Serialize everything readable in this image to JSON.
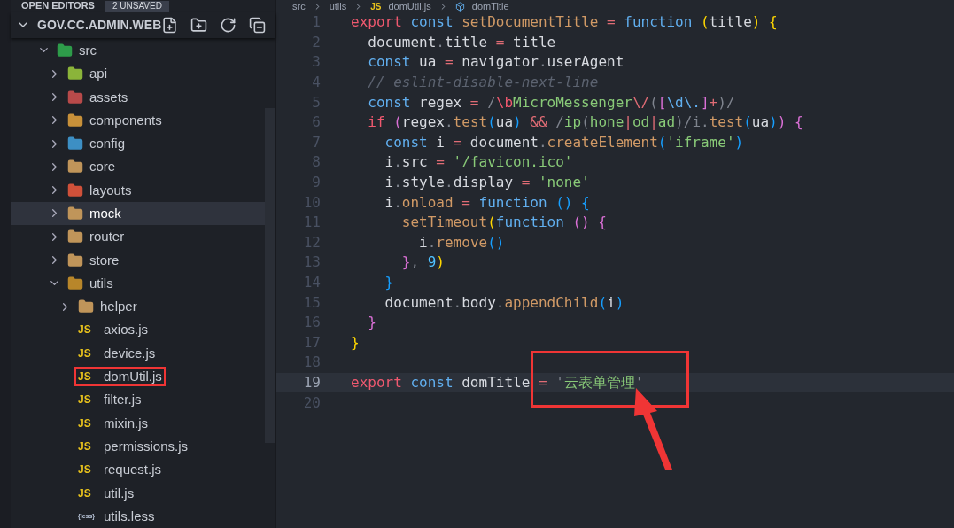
{
  "open_editors": {
    "title": "OPEN EDITORS",
    "badge": "2 UNSAVED"
  },
  "project": {
    "title": "GOV.CC.ADMIN.WEB",
    "expanded": true
  },
  "tree": [
    {
      "name": "src",
      "kind": "folder",
      "color": "#2e9c4a",
      "expanded": true,
      "selected": false,
      "children": [
        {
          "name": "api",
          "kind": "folder",
          "color": "#8bb43a",
          "expanded": false,
          "selected": false
        },
        {
          "name": "assets",
          "kind": "folder",
          "color": "#b84a4a",
          "expanded": false,
          "selected": false
        },
        {
          "name": "components",
          "kind": "folder",
          "color": "#c8913a",
          "expanded": false,
          "selected": false
        },
        {
          "name": "config",
          "kind": "folder",
          "color": "#3d8fc4",
          "expanded": false,
          "selected": false
        },
        {
          "name": "core",
          "kind": "folder",
          "color": "#c0955a",
          "expanded": false,
          "selected": false
        },
        {
          "name": "layouts",
          "kind": "folder",
          "color": "#d0513a",
          "expanded": false,
          "selected": false
        },
        {
          "name": "mock",
          "kind": "folder",
          "color": "#c0955a",
          "expanded": false,
          "selected": true
        },
        {
          "name": "router",
          "kind": "folder",
          "color": "#c0955a",
          "expanded": false,
          "selected": false
        },
        {
          "name": "store",
          "kind": "folder",
          "color": "#c0955a",
          "expanded": false,
          "selected": false
        },
        {
          "name": "utils",
          "kind": "folder",
          "color": "#b8862a",
          "expanded": true,
          "selected": false,
          "children": [
            {
              "name": "helper",
              "kind": "folder",
              "color": "#c0955a",
              "expanded": false,
              "selected": false,
              "annotated": false
            },
            {
              "name": "axios.js",
              "kind": "js",
              "badge": "JS",
              "selected": false,
              "annotated": false
            },
            {
              "name": "device.js",
              "kind": "js",
              "badge": "JS",
              "selected": false,
              "annotated": false
            },
            {
              "name": "domUtil.js",
              "kind": "js",
              "badge": "JS",
              "selected": false,
              "annotated": true
            },
            {
              "name": "filter.js",
              "kind": "js",
              "badge": "JS",
              "selected": false,
              "annotated": false
            },
            {
              "name": "mixin.js",
              "kind": "js",
              "badge": "JS",
              "selected": false,
              "annotated": false
            },
            {
              "name": "permissions.js",
              "kind": "js",
              "badge": "JS",
              "selected": false,
              "annotated": false
            },
            {
              "name": "request.js",
              "kind": "js",
              "badge": "JS",
              "selected": false,
              "annotated": false
            },
            {
              "name": "util.js",
              "kind": "js",
              "badge": "JS",
              "selected": false,
              "annotated": false
            },
            {
              "name": "utils.less",
              "kind": "less",
              "badge": "{less}",
              "selected": false,
              "annotated": false
            }
          ]
        }
      ]
    }
  ],
  "breadcrumb": [
    {
      "text": "src",
      "kind": "folder"
    },
    {
      "text": "utils",
      "kind": "folder"
    },
    {
      "text": "domUtil.js",
      "kind": "js",
      "badge": "JS"
    },
    {
      "text": "domTitle",
      "kind": "symbol"
    }
  ],
  "editor": {
    "lines": [
      {
        "number": "1",
        "current": false,
        "tokens": [
          {
            "text": "export",
            "kind": "kw"
          },
          {
            "text": " const",
            "kind": "st"
          },
          {
            "text": " setDocumentTitle",
            "kind": "fn"
          },
          {
            "text": " =",
            "kind": "op"
          },
          {
            "text": " function",
            "kind": "st"
          },
          {
            "text": " (",
            "kind": "b1"
          },
          {
            "text": "title",
            "kind": "id"
          },
          {
            "text": ")",
            "kind": "b1"
          },
          {
            "text": " {",
            "kind": "b1"
          }
        ]
      },
      {
        "number": "2",
        "current": false,
        "tokens": [
          {
            "text": "  document",
            "kind": "id"
          },
          {
            "text": ".",
            "kind": "pn"
          },
          {
            "text": "title",
            "kind": "id"
          },
          {
            "text": " =",
            "kind": "op"
          },
          {
            "text": " title",
            "kind": "id"
          }
        ]
      },
      {
        "number": "3",
        "current": false,
        "tokens": [
          {
            "text": "  const",
            "kind": "st"
          },
          {
            "text": " ua",
            "kind": "id"
          },
          {
            "text": " =",
            "kind": "op"
          },
          {
            "text": " navigator",
            "kind": "id"
          },
          {
            "text": ".",
            "kind": "pn"
          },
          {
            "text": "userAgent",
            "kind": "id"
          }
        ]
      },
      {
        "number": "4",
        "current": false,
        "tokens": [
          {
            "text": "  // eslint-disable-next-line",
            "kind": "cm"
          }
        ]
      },
      {
        "number": "5",
        "current": false,
        "tokens": [
          {
            "text": "  const",
            "kind": "st"
          },
          {
            "text": " regex",
            "kind": "id"
          },
          {
            "text": " =",
            "kind": "op"
          },
          {
            "text": " /",
            "kind": "pn"
          },
          {
            "text": "\\b",
            "kind": "kw"
          },
          {
            "text": "MicroMessenger",
            "kind": "str"
          },
          {
            "text": "\\/",
            "kind": "op"
          },
          {
            "text": "(",
            "kind": "pn"
          },
          {
            "text": "[",
            "kind": "b2"
          },
          {
            "text": "\\d\\.",
            "kind": "st"
          },
          {
            "text": "]",
            "kind": "b2"
          },
          {
            "text": "+",
            "kind": "op"
          },
          {
            "text": ")/",
            "kind": "pn"
          }
        ]
      },
      {
        "number": "6",
        "current": false,
        "tokens": [
          {
            "text": "  if",
            "kind": "kw"
          },
          {
            "text": " (",
            "kind": "b2"
          },
          {
            "text": "regex",
            "kind": "id"
          },
          {
            "text": ".",
            "kind": "pn"
          },
          {
            "text": "test",
            "kind": "fn"
          },
          {
            "text": "(",
            "kind": "b3"
          },
          {
            "text": "ua",
            "kind": "id"
          },
          {
            "text": ")",
            "kind": "b3"
          },
          {
            "text": " &&",
            "kind": "op"
          },
          {
            "text": " /",
            "kind": "pn"
          },
          {
            "text": "ip",
            "kind": "str"
          },
          {
            "text": "(",
            "kind": "pn"
          },
          {
            "text": "hone",
            "kind": "str"
          },
          {
            "text": "|",
            "kind": "op"
          },
          {
            "text": "od",
            "kind": "str"
          },
          {
            "text": "|",
            "kind": "op"
          },
          {
            "text": "ad",
            "kind": "str"
          },
          {
            "text": ")/i.",
            "kind": "pn"
          },
          {
            "text": "test",
            "kind": "fn"
          },
          {
            "text": "(",
            "kind": "b3"
          },
          {
            "text": "ua",
            "kind": "id"
          },
          {
            "text": ")",
            "kind": "b3"
          },
          {
            "text": ")",
            "kind": "b2"
          },
          {
            "text": " {",
            "kind": "b2"
          }
        ]
      },
      {
        "number": "7",
        "current": false,
        "tokens": [
          {
            "text": "    const",
            "kind": "st"
          },
          {
            "text": " i",
            "kind": "id"
          },
          {
            "text": " =",
            "kind": "op"
          },
          {
            "text": " document",
            "kind": "id"
          },
          {
            "text": ".",
            "kind": "pn"
          },
          {
            "text": "createElement",
            "kind": "fn"
          },
          {
            "text": "(",
            "kind": "b3"
          },
          {
            "text": "'iframe'",
            "kind": "str"
          },
          {
            "text": ")",
            "kind": "b3"
          }
        ]
      },
      {
        "number": "8",
        "current": false,
        "tokens": [
          {
            "text": "    i",
            "kind": "id"
          },
          {
            "text": ".",
            "kind": "pn"
          },
          {
            "text": "src",
            "kind": "id"
          },
          {
            "text": " =",
            "kind": "op"
          },
          {
            "text": " '/favicon.ico'",
            "kind": "str"
          }
        ]
      },
      {
        "number": "9",
        "current": false,
        "tokens": [
          {
            "text": "    i",
            "kind": "id"
          },
          {
            "text": ".",
            "kind": "pn"
          },
          {
            "text": "style",
            "kind": "id"
          },
          {
            "text": ".",
            "kind": "pn"
          },
          {
            "text": "display",
            "kind": "id"
          },
          {
            "text": " =",
            "kind": "op"
          },
          {
            "text": " 'none'",
            "kind": "str"
          }
        ]
      },
      {
        "number": "10",
        "current": false,
        "tokens": [
          {
            "text": "    i",
            "kind": "id"
          },
          {
            "text": ".",
            "kind": "pn"
          },
          {
            "text": "onload",
            "kind": "fn"
          },
          {
            "text": " =",
            "kind": "op"
          },
          {
            "text": " function",
            "kind": "st"
          },
          {
            "text": " ()",
            "kind": "b3"
          },
          {
            "text": " {",
            "kind": "b3"
          }
        ]
      },
      {
        "number": "11",
        "current": false,
        "tokens": [
          {
            "text": "      setTimeout",
            "kind": "fn"
          },
          {
            "text": "(",
            "kind": "b1"
          },
          {
            "text": "function",
            "kind": "st"
          },
          {
            "text": " ()",
            "kind": "b2"
          },
          {
            "text": " {",
            "kind": "b2"
          }
        ]
      },
      {
        "number": "12",
        "current": false,
        "tokens": [
          {
            "text": "        i",
            "kind": "id"
          },
          {
            "text": ".",
            "kind": "pn"
          },
          {
            "text": "remove",
            "kind": "fn"
          },
          {
            "text": "()",
            "kind": "b3"
          }
        ]
      },
      {
        "number": "13",
        "current": false,
        "tokens": [
          {
            "text": "      }",
            "kind": "b2"
          },
          {
            "text": ",",
            "kind": "pn"
          },
          {
            "text": " 9",
            "kind": "num"
          },
          {
            "text": ")",
            "kind": "b1"
          }
        ]
      },
      {
        "number": "14",
        "current": false,
        "tokens": [
          {
            "text": "    }",
            "kind": "b3"
          }
        ]
      },
      {
        "number": "15",
        "current": false,
        "tokens": [
          {
            "text": "    document",
            "kind": "id"
          },
          {
            "text": ".",
            "kind": "pn"
          },
          {
            "text": "body",
            "kind": "id"
          },
          {
            "text": ".",
            "kind": "pn"
          },
          {
            "text": "appendChild",
            "kind": "fn"
          },
          {
            "text": "(",
            "kind": "b3"
          },
          {
            "text": "i",
            "kind": "id"
          },
          {
            "text": ")",
            "kind": "b3"
          }
        ]
      },
      {
        "number": "16",
        "current": false,
        "tokens": [
          {
            "text": "  }",
            "kind": "b2"
          }
        ]
      },
      {
        "number": "17",
        "current": false,
        "tokens": [
          {
            "text": "}",
            "kind": "b1"
          }
        ]
      },
      {
        "number": "18",
        "current": false
      },
      {
        "number": "19",
        "current": true,
        "tokens": [
          {
            "text": "export",
            "kind": "kw"
          },
          {
            "text": " const",
            "kind": "st"
          },
          {
            "text": " domTitle",
            "kind": "id"
          },
          {
            "text": " =",
            "kind": "op"
          },
          {
            "text": " '",
            "kind": "pn"
          },
          {
            "text": "云表单管理",
            "kind": "str"
          },
          {
            "text": "'",
            "kind": "pn"
          }
        ]
      },
      {
        "number": "20",
        "current": false
      }
    ]
  }
}
